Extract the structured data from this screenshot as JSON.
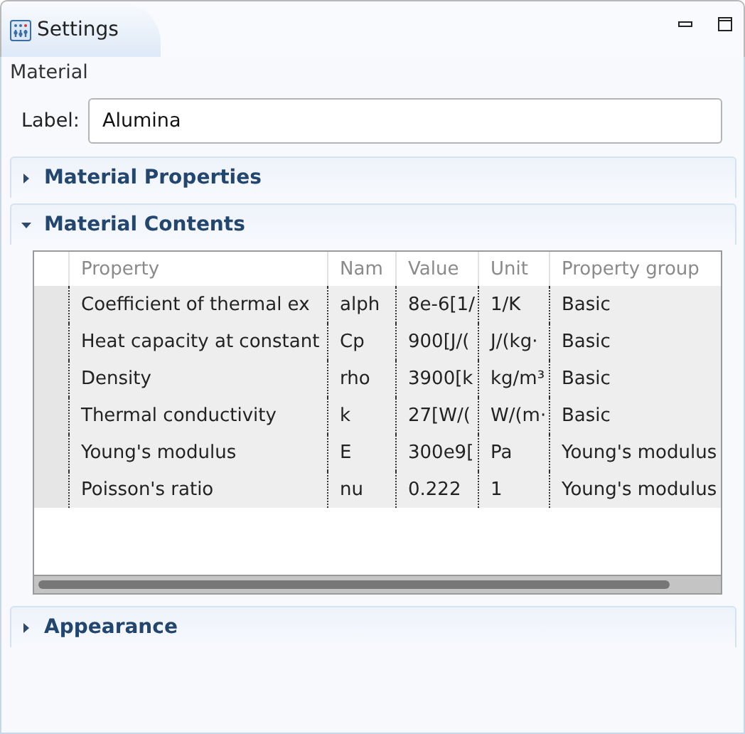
{
  "tab": {
    "title": "Settings"
  },
  "node_type": "Material",
  "label_field": {
    "label": "Label:",
    "value": "Alumina"
  },
  "sections": [
    {
      "title": "Material Properties",
      "expanded": false
    },
    {
      "title": "Material Contents",
      "expanded": true,
      "table": {
        "columns": [
          "Property",
          "Nam",
          "Value",
          "Unit",
          "Property group"
        ],
        "rows": [
          [
            "Coefficient of thermal ex",
            "alph",
            "8e-6[1/",
            "1/K",
            "Basic"
          ],
          [
            "Heat capacity at constant",
            "Cp",
            "900[J/(",
            "J/(kg·",
            "Basic"
          ],
          [
            "Density",
            "rho",
            "3900[k",
            "kg/m³",
            "Basic"
          ],
          [
            "Thermal conductivity",
            "k",
            "27[W/(",
            "W/(m·",
            "Basic"
          ],
          [
            "Young's modulus",
            "E",
            "300e9[",
            "Pa",
            "Young's modulus"
          ],
          [
            "Poisson's ratio",
            "nu",
            "0.222",
            "1",
            "Young's modulus"
          ]
        ]
      }
    },
    {
      "title": "Appearance",
      "expanded": false
    }
  ]
}
